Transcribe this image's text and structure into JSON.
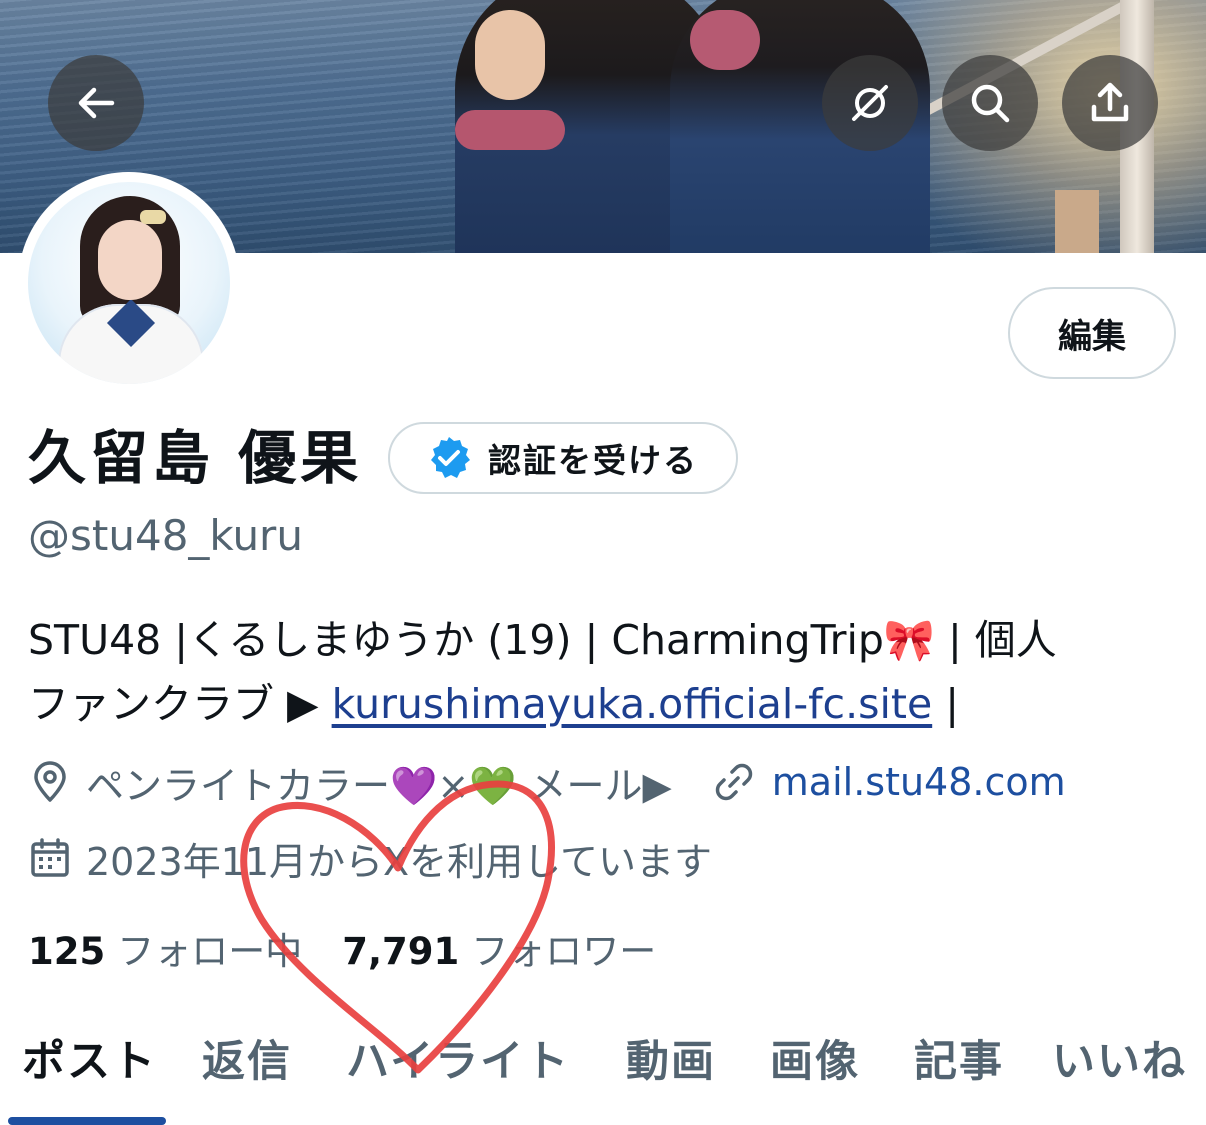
{
  "header": {
    "back_icon": "arrow-left-icon",
    "grok_icon": "grok-icon",
    "search_icon": "search-icon",
    "share_icon": "share-icon"
  },
  "profile": {
    "edit_label": "編集",
    "display_name": "久留島 優果",
    "verify_label": "認証を受ける",
    "handle": "@stu48_kuru",
    "bio_line1": "STU48 |くるしまゆうか (19) | CharmingTrip🎀 | 個人",
    "bio_line2_prefix": "ファンクラブ ▶︎ ",
    "bio_link": "kurushimayuka.official-fc.site",
    "bio_line2_suffix": " |",
    "location": "ペンライトカラー💜×💚 メール▶︎",
    "website": "mail.stu48.com",
    "joined": "2023年11月からXを利用しています",
    "following_count": "125",
    "following_label": "フォロー中",
    "followers_count": "7,791",
    "followers_label": "フォロワー"
  },
  "tabs": [
    {
      "label": "ポスト",
      "active": true
    },
    {
      "label": "返信",
      "active": false
    },
    {
      "label": "ハイライト",
      "active": false
    },
    {
      "label": "動画",
      "active": false
    },
    {
      "label": "画像",
      "active": false
    },
    {
      "label": "記事",
      "active": false
    },
    {
      "label": "いいね",
      "active": false
    }
  ],
  "colors": {
    "accent": "#1d9bf0",
    "link": "#1d4fa0",
    "muted_text": "#536471",
    "heart_drawing": "#e8403f"
  }
}
